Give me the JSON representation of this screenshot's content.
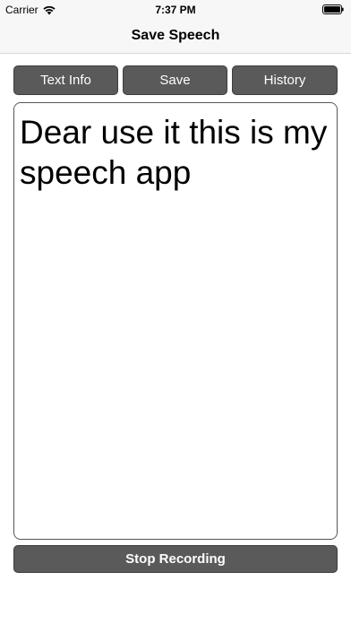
{
  "status_bar": {
    "carrier": "Carrier",
    "time": "7:37 PM",
    "wifi_icon": "wifi-icon",
    "battery_icon": "battery-icon"
  },
  "nav": {
    "title": "Save Speech"
  },
  "toolbar": {
    "text_info_label": "Text Info",
    "save_label": "Save",
    "history_label": "History"
  },
  "speech": {
    "text": "Dear use it this is my speech app"
  },
  "footer": {
    "stop_label": "Stop Recording"
  },
  "colors": {
    "button_bg": "#5a5a5a",
    "button_text": "#ffffff",
    "bar_bg": "#f7f7f7"
  }
}
